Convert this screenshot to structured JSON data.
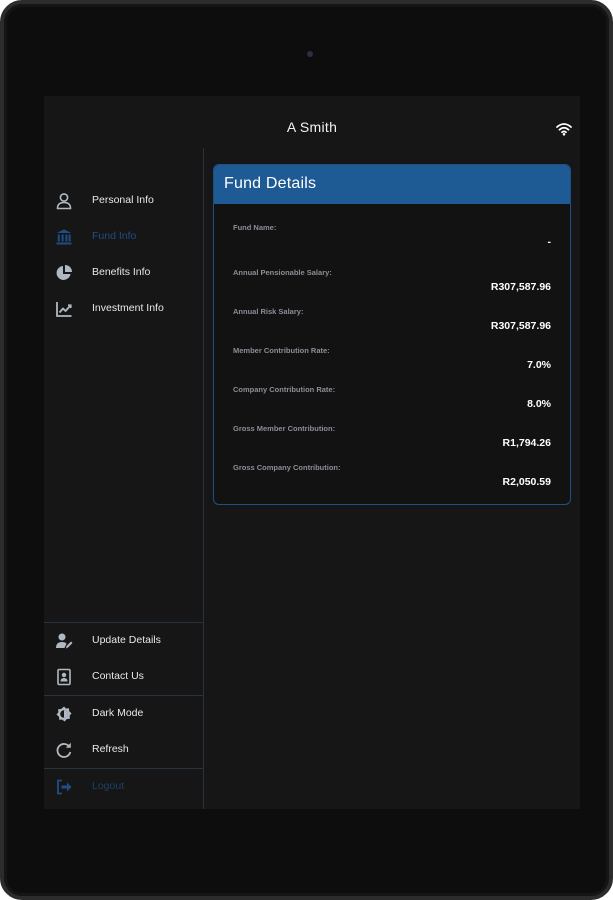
{
  "header": {
    "title": "A Smith"
  },
  "icons": {
    "wifi": "wifi-icon",
    "personal": "person-icon",
    "fund": "bank-icon",
    "benefits": "pie-chart-icon",
    "investment": "line-chart-icon",
    "update": "user-edit-icon",
    "contact": "contact-card-icon",
    "dark": "dark-mode-icon",
    "refresh": "refresh-icon",
    "logout": "logout-icon"
  },
  "colors": {
    "accent": "#1e5a94",
    "active_nav": "#1f4e86",
    "background": "#161616"
  },
  "sidebar": {
    "items": [
      {
        "label": "Personal Info"
      },
      {
        "label": "Fund Info"
      },
      {
        "label": "Benefits Info"
      },
      {
        "label": "Investment Info"
      }
    ],
    "bottom": [
      {
        "label": "Update Details"
      },
      {
        "label": "Contact Us"
      },
      {
        "label": "Dark Mode"
      },
      {
        "label": "Refresh"
      },
      {
        "label": "Logout"
      }
    ]
  },
  "card": {
    "title": "Fund Details",
    "rows": [
      {
        "label": "Fund Name:",
        "value": "-"
      },
      {
        "label": "Annual Pensionable Salary:",
        "value": "R307,587.96"
      },
      {
        "label": "Annual Risk Salary:",
        "value": "R307,587.96"
      },
      {
        "label": "Member Contribution Rate:",
        "value": "7.0%"
      },
      {
        "label": "Company Contribution Rate:",
        "value": "8.0%"
      },
      {
        "label": "Gross Member Contribution:",
        "value": "R1,794.26"
      },
      {
        "label": "Gross Company Contribution:",
        "value": "R2,050.59"
      }
    ]
  }
}
